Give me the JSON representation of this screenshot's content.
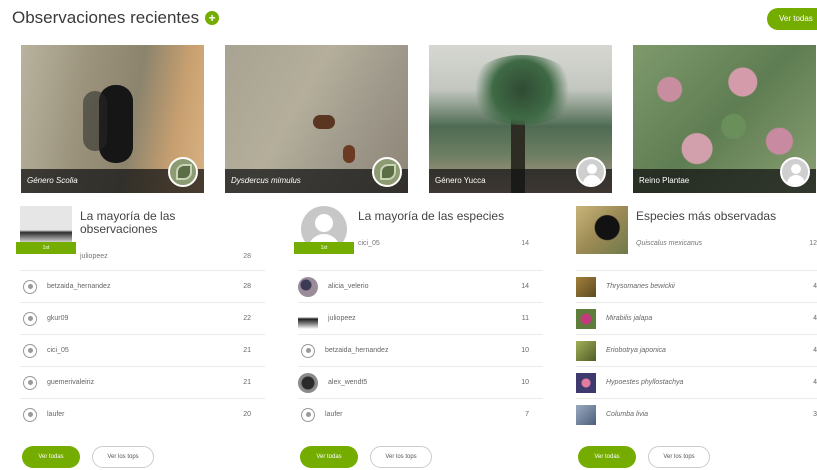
{
  "header": {
    "title": "Observaciones recientes",
    "see_all": "Ver todas"
  },
  "photos": [
    {
      "caption": "Género Scolia",
      "badge": "taxon"
    },
    {
      "caption": "Dysdercus mimulus",
      "badge": "taxon"
    },
    {
      "caption": "Género Yucca",
      "badge": "user"
    },
    {
      "caption": "Reino Plantae",
      "badge": "user"
    }
  ],
  "observers": {
    "title": "La mayoría de las observaciones",
    "top_name": "juliopeez",
    "top_count": "28",
    "rows": [
      {
        "name": "betzaida_hernandez",
        "count": "28"
      },
      {
        "name": "gkur09",
        "count": "22"
      },
      {
        "name": "cici_05",
        "count": "21"
      },
      {
        "name": "guemerivaleiriz",
        "count": "21"
      },
      {
        "name": "laufer",
        "count": "20"
      }
    ],
    "btn_all": "Ver todas",
    "btn_top": "Ver los tops"
  },
  "species_observers": {
    "title": "La mayoría de las especies",
    "top_name": "cici_05",
    "top_count": "14",
    "rows": [
      {
        "name": "alicia_velerio",
        "count": "14"
      },
      {
        "name": "juliopeez",
        "count": "11"
      },
      {
        "name": "betzaida_hernandez",
        "count": "10"
      },
      {
        "name": "alex_wendt5",
        "count": "10"
      },
      {
        "name": "laufer",
        "count": "7"
      }
    ],
    "btn_all": "Ver todas",
    "btn_top": "Ver los tops"
  },
  "top_species": {
    "title": "Especies más observadas",
    "top_name": "Quiscalus mexicanus",
    "top_count": "12",
    "rows": [
      {
        "name": "Thrysomanes bewickii",
        "count": "4"
      },
      {
        "name": "Mirabilis jalapa",
        "count": "4"
      },
      {
        "name": "Eriobotrya japonica",
        "count": "4"
      },
      {
        "name": "Hypoestes phyllostachya",
        "count": "4"
      },
      {
        "name": "Columba livia",
        "count": "3"
      }
    ],
    "btn_all": "Ver todas",
    "btn_top": "Ver los tops"
  },
  "colors": {
    "accent": "#74ac00"
  },
  "icons": [
    "plus-icon",
    "user-icon"
  ]
}
